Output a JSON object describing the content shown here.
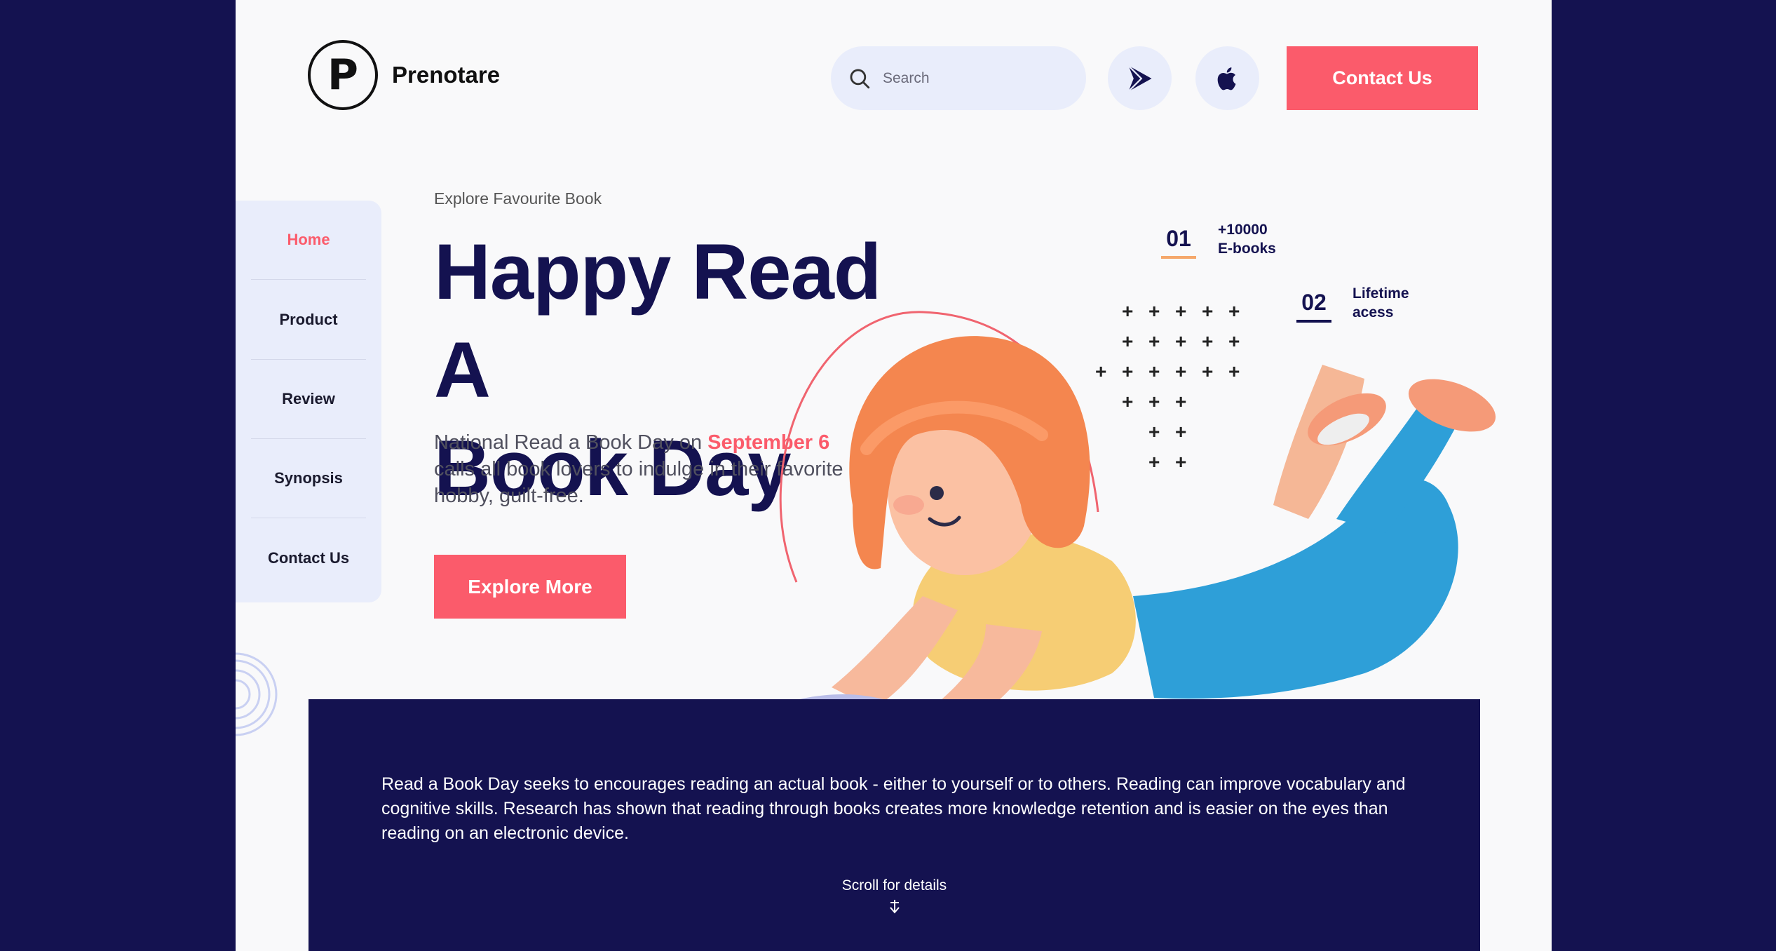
{
  "header": {
    "logo_letter": "P",
    "brand": "Prenotare",
    "search_placeholder": "Search",
    "contact_label": "Contact Us"
  },
  "nav": {
    "items": [
      "Home",
      "Product",
      "Review",
      "Synopsis",
      "Contact Us"
    ],
    "active": "Home"
  },
  "hero": {
    "eyebrow": "Explore Favourite Book",
    "title_line1": "Happy Read A",
    "title_line2": "Book Day",
    "desc_prefix": "National Read a Book Day on ",
    "desc_date": "September 6",
    "desc_suffix": " calls all book lovers to indulge in their favorite hobby, guilt-free.",
    "cta": "Explore More"
  },
  "stats": [
    {
      "num": "01",
      "label_line1": "+10000",
      "label_line2": "E-books",
      "underline_color": "#f5a86b"
    },
    {
      "num": "02",
      "label_line1": "Lifetime",
      "label_line2": "acess",
      "underline_color": "#141250"
    }
  ],
  "band": {
    "text": "Read a Book Day seeks to encourages reading an actual book - either to yourself or to others. Reading can improve vocabulary and cognitive skills. Research has shown that reading through books creates more knowledge retention and is easier on the eyes than reading on an electronic device.",
    "scroll_label": "Scroll for details"
  },
  "colors": {
    "navy": "#141250",
    "accent": "#fb5b6b",
    "soft": "#e9edfb"
  },
  "icons": [
    "search-icon",
    "google-play-icon",
    "apple-icon",
    "arrow-down-icon"
  ]
}
